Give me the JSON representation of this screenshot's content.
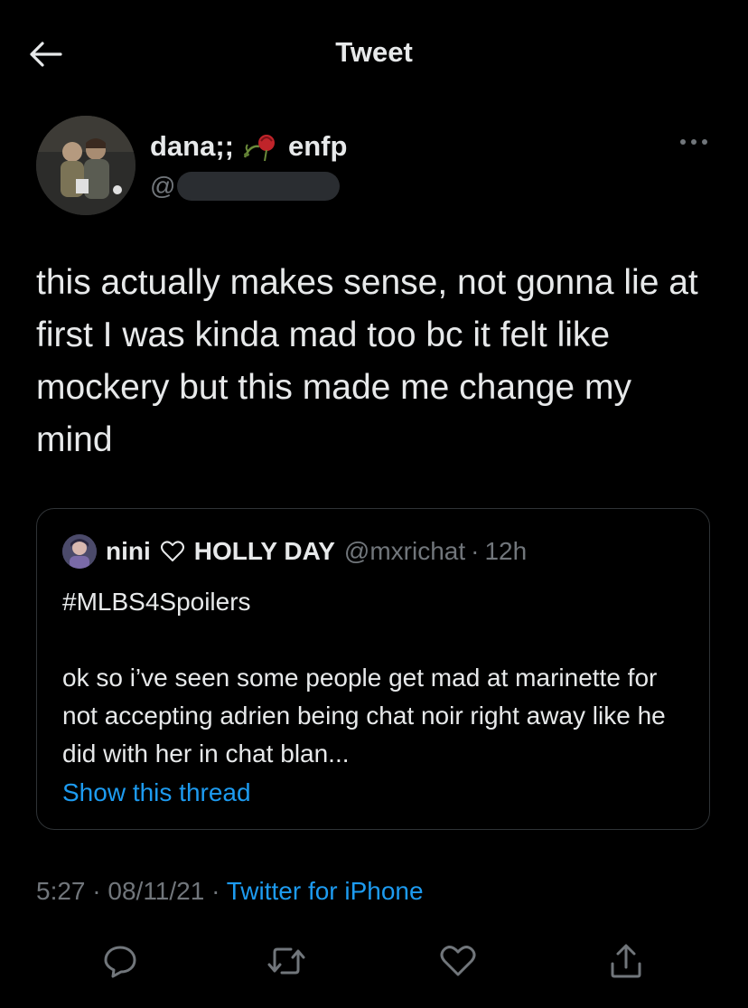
{
  "header": {
    "title": "Tweet",
    "back_icon": "arrow-left-icon"
  },
  "author": {
    "display_name_part1": "dana;;",
    "display_name_emoji": "wilted-rose-emoji",
    "display_name_part2": "enfp",
    "handle_prefix": "@",
    "more_icon": "more-horizontal-icon"
  },
  "tweet": {
    "text": "this actually makes sense, not gonna lie at first I was kinda mad too bc it felt like mockery but this made me change my mind"
  },
  "quote": {
    "name_part1": "nini",
    "name_part2": "HOLLY DAY",
    "handle": "@mxrichat",
    "separator": "·",
    "time": "12h",
    "hashtag": "#MLBS4Spoilers",
    "body": "ok so i’ve seen some people get mad at marinette for not accepting adrien being chat noir right away like he did with her in chat blan...",
    "show_thread": "Show this thread"
  },
  "meta": {
    "time": "5:27",
    "separator": "·",
    "date": "08/11/21",
    "source": "Twitter for iPhone"
  },
  "actions": {
    "reply_icon": "reply-icon",
    "retweet_icon": "retweet-icon",
    "like_icon": "heart-icon",
    "share_icon": "share-icon"
  },
  "colors": {
    "background": "#000000",
    "text": "#e7e9ea",
    "secondary": "#71767b",
    "accent": "#1d9bf0",
    "border": "#2f3336"
  }
}
